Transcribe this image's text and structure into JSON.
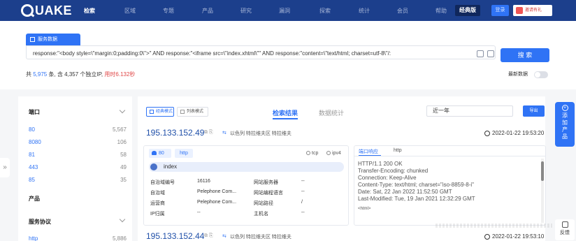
{
  "nav": {
    "logo": "UAKE",
    "items": [
      "检索",
      "区域",
      "专题",
      "产品",
      "研究",
      "漏洞",
      "探索",
      "统计",
      "会员",
      "帮助"
    ],
    "classic": "经典版",
    "login": "登录",
    "invite": "邀请有礼"
  },
  "search": {
    "tab_label": "服务数据",
    "query": "response:\"<body style=\\\"margin:0;padding:0\\\">\" AND response:\"<iframe src=\\\"index.xhtml\\\"\" AND response:\"content=\\\"text/html; charset=utf-8\\\"/:",
    "button": "搜 索",
    "stats": {
      "prefix": "共",
      "count": "5,975",
      "mid": "条, 含 4,357 个独立IP,",
      "time": "用时6.132秒"
    },
    "latest_label": "最新数据"
  },
  "sidebar": {
    "port_title": "端口",
    "ports": [
      {
        "k": "80",
        "v": "5,567"
      },
      {
        "k": "8080",
        "v": "106"
      },
      {
        "k": "81",
        "v": "58"
      },
      {
        "k": "443",
        "v": "49"
      },
      {
        "k": "85",
        "v": "35"
      }
    ],
    "product_title": "产品",
    "service_title": "服务协议",
    "services": [
      {
        "k": "http",
        "v": "5,886"
      }
    ]
  },
  "main": {
    "mode_card": "经典模式",
    "mode_list": "列表模式",
    "tab_results": "检索结果",
    "tab_stats": "数据统计",
    "range": "近一年",
    "export": "导出",
    "results": [
      {
        "ip": "195.133.152.49",
        "tags": "以色列 特拉维夫区 特拉维夫",
        "time": "2022-01-22 19:53:20",
        "port": "80",
        "proto": "http",
        "transport": "tcp",
        "ipver": "ipv4",
        "title": "index",
        "fields": {
          "asn_label": "自治域编号",
          "asn": "16116",
          "as_label": "自治域",
          "as": "Pelephone Com...",
          "isp_label": "运营商",
          "isp": "Pelephone Com...",
          "owner_label": "IP归属",
          "owner": "--",
          "server_label": "网站服务器",
          "server": "--",
          "lang_label": "网站编程语言",
          "lang": "--",
          "path_label": "网站路径",
          "path": "/",
          "host_label": "主机名",
          "host": "--"
        },
        "response_tab": "端口响应",
        "response_tab2": "http",
        "response_lines": [
          "HTTP/1.1 200 OK",
          "Transfer-Encoding: chunked",
          "Connection: Keep-Alive",
          "Content-Type: text/html; charset=\"iso-8859-8-i\"",
          "Date: Sat, 22 Jan 2022 11:52:50 GMT",
          "Last-Modified: Tue, 19 Jan 2021 12:32:29 GMT",
          "<html>"
        ]
      },
      {
        "ip": "195.133.152.44",
        "tags": "以色列 特拉维夫区 特拉维夫",
        "time": "2022-01-22 19:53:10"
      }
    ]
  },
  "float": {
    "add_product": [
      "添",
      "加",
      "产",
      "品"
    ],
    "feedback": "反馈"
  }
}
